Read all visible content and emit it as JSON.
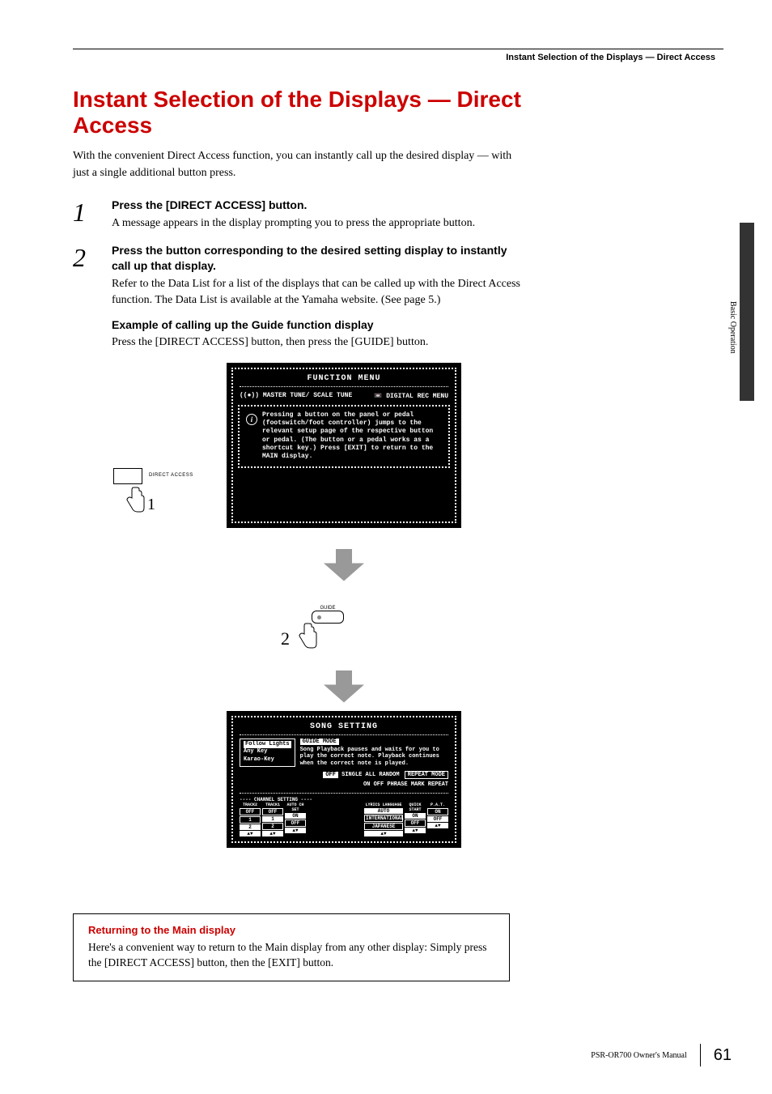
{
  "header": {
    "breadcrumb": "Instant Selection of the Displays — Direct Access"
  },
  "title": "Instant Selection of the Displays — Direct Access",
  "intro": "With the convenient Direct Access function, you can instantly call up the desired display — with just a single additional button press.",
  "steps": [
    {
      "num": "1",
      "head": "Press the [DIRECT ACCESS] button.",
      "text": "A message appears in the display prompting you to press the appropriate button."
    },
    {
      "num": "2",
      "head": "Press the button corresponding to the desired setting display to instantly call up that display.",
      "text": "Refer to the Data List for a list of the displays that can be called up with the Direct Access function. The Data List is available at the Yamaha website. (See page 5.)"
    }
  ],
  "example": {
    "head": "Example of calling up the Guide function display",
    "text": "Press the [DIRECT ACCESS] button, then press the [GUIDE] button."
  },
  "figure": {
    "direct_access_label": "DIRECT ACCESS",
    "hand1_num": "1",
    "guide_label": "GUIDE",
    "hand2_num": "2",
    "lcd1": {
      "title": "FUNCTION MENU",
      "left_item_icon": "((●))",
      "left_item": "MASTER TUNE/ SCALE TUNE",
      "right_item_icon": "📼",
      "right_item": "DIGITAL REC MENU",
      "info": "Pressing a button on the panel or pedal (footswitch/foot controller) jumps to the relevant setup page of the respective button or pedal. (The button or a pedal works as a shortcut key.) Press [EXIT] to return to the MAIN display."
    },
    "lcd2": {
      "title": "SONG SETTING",
      "guide_modes": [
        "Follow Lights",
        "Any Key",
        "Karao-Key"
      ],
      "guide_tag": "GUIDE MODE",
      "guide_desc": "Song Playback pauses and waits for you to play the correct note. Playback continues when the correct note is played.",
      "repeat": {
        "off": "OFF",
        "opts": "SINGLE ALL RANDOM",
        "label": "REPEAT MODE"
      },
      "phrase": {
        "on": "ON",
        "off": "OFF",
        "label": "PHRASE MARK REPEAT"
      },
      "ch_title": "CHANNEL SETTING",
      "ch_left": [
        {
          "lbl": "TRACK2",
          "vals": [
            "OFF",
            "1",
            "2"
          ]
        },
        {
          "lbl": "TRACK1",
          "vals": [
            "OFF",
            "1",
            "2"
          ]
        },
        {
          "lbl": "AUTO CH SET",
          "vals": [
            "ON",
            "OFF"
          ]
        }
      ],
      "ch_right": [
        {
          "lbl": "LYRICS LANGUAGE",
          "vals": [
            "AUTO",
            "INTERNATIONAL",
            "JAPANESE"
          ]
        },
        {
          "lbl": "QUICK START",
          "vals": [
            "ON",
            "OFF"
          ]
        },
        {
          "lbl": "P.A.T.",
          "vals": [
            "ON",
            "OFF"
          ]
        }
      ]
    }
  },
  "note": {
    "title": "Returning to the Main display",
    "text": "Here's a convenient way to return to the Main display from any other display: Simply press the [DIRECT ACCESS] button, then the [EXIT] button."
  },
  "side_tab": "Basic Operation",
  "footer": {
    "manual": "PSR-OR700 Owner's Manual",
    "page": "61"
  }
}
